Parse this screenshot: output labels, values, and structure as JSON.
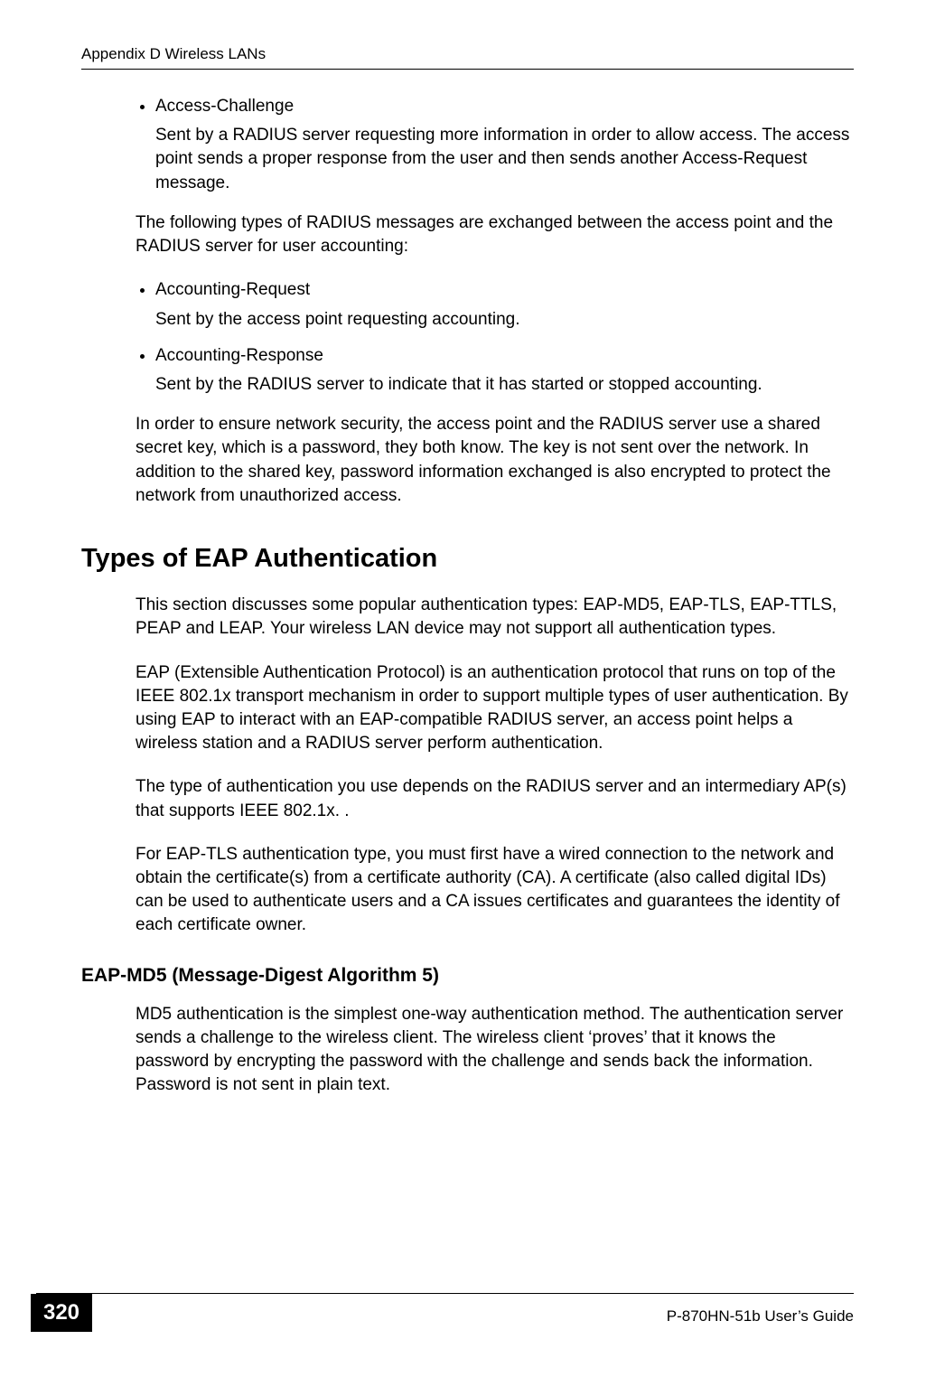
{
  "header": "Appendix D Wireless LANs",
  "bullets1": [
    {
      "title": "Access-Challenge",
      "desc": "Sent by a RADIUS server requesting more information in order to allow access. The access point sends a proper response from the user and then sends another Access-Request message."
    }
  ],
  "p1": "The following types of RADIUS messages are exchanged between the access point and the RADIUS server for user accounting:",
  "bullets2": [
    {
      "title": "Accounting-Request",
      "desc": "Sent by the access point requesting accounting."
    },
    {
      "title": "Accounting-Response",
      "desc": "Sent by the RADIUS server to indicate that it has started or stopped accounting."
    }
  ],
  "p2": "In order to ensure network security, the access point and the RADIUS server use a shared secret key, which is a password, they both know. The key is not sent over the network. In addition to the shared key, password information exchanged is also encrypted to protect the network from unauthorized access.",
  "section_title": "Types of EAP Authentication",
  "p3": "This section discusses some popular authentication types: EAP-MD5, EAP-TLS, EAP-TTLS, PEAP and LEAP. Your wireless LAN device may not support all authentication types.",
  "p4": "EAP (Extensible Authentication Protocol) is an authentication protocol that runs on top of the IEEE 802.1x transport mechanism in order to support multiple types of user authentication. By using EAP to interact with an EAP-compatible RADIUS server, an access point helps a wireless station and a RADIUS server perform authentication.",
  "p5": "The type of authentication you use depends on the RADIUS server and an intermediary AP(s) that supports IEEE 802.1x. .",
  "p6": "For EAP-TLS authentication type, you must first have a wired connection to the network and obtain the certificate(s) from a certificate authority (CA). A certificate (also called digital IDs) can be used to authenticate users and a CA issues certificates and guarantees the identity of each certificate owner.",
  "subsection_title": "EAP-MD5 (Message-Digest Algorithm 5)",
  "p7": "MD5 authentication is the simplest one-way authentication method. The authentication server sends a challenge to the wireless client. The wireless client ‘proves’ that it knows the password by encrypting the password with the challenge and sends back the information. Password is not sent in plain text.",
  "page_number": "320",
  "guide_name": "P-870HN-51b User’s Guide"
}
